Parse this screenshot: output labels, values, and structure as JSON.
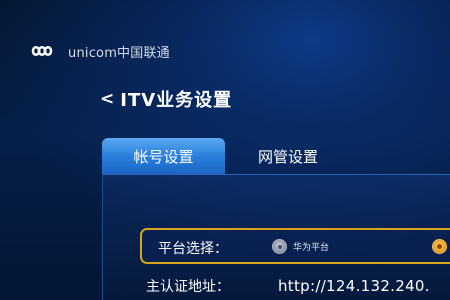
{
  "brand": {
    "text": "unicom中国联通",
    "logo_icon": "china-unicom-knot-icon"
  },
  "header": {
    "back_glyph": "<",
    "title": "ITV业务设置"
  },
  "tabs": [
    {
      "label": "帐号设置",
      "active": true
    },
    {
      "label": "网管设置",
      "active": false
    }
  ],
  "settings": {
    "platform": {
      "label": "平台选择：",
      "options": [
        {
          "label": "华为平台",
          "selected": false
        },
        {
          "label": "",
          "selected": true
        }
      ]
    },
    "auth_address": {
      "label": "主认证地址：",
      "value": "http://124.132.240."
    }
  },
  "colors": {
    "active_tab": "#2a7fdc",
    "focus_border": "#d8a21a",
    "background": "#06204a"
  }
}
